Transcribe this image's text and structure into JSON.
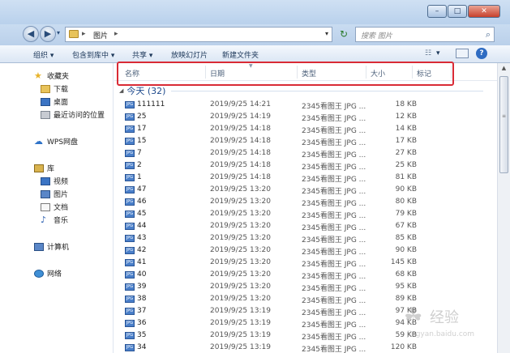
{
  "window": {
    "minimize": "–",
    "maximize": "□",
    "close": "✕"
  },
  "address": {
    "back_icon": "◀",
    "forward_icon": "▶",
    "path_sep_1": "▸",
    "path": "图片",
    "path_sep_2": "▸",
    "dropdown": "▾",
    "refresh_icon": "↻",
    "search_placeholder": "搜索 图片",
    "search_icon": "search-icon"
  },
  "toolbar": {
    "organize": "组织 ▾",
    "include_in_library": "包含到库中 ▾",
    "share": "共享 ▾",
    "slideshow": "放映幻灯片",
    "new_folder": "新建文件夹",
    "view_menu": "▾",
    "help": "?"
  },
  "nav": {
    "favorites": "收藏夹",
    "downloads": "下载",
    "desktop": "桌面",
    "recent": "最近访问的位置",
    "wps": "WPS网盘",
    "libraries": "库",
    "videos": "视频",
    "pictures": "图片",
    "documents": "文档",
    "music": "音乐",
    "computer": "计算机",
    "network": "网络"
  },
  "columns": {
    "name": "名称",
    "date": "日期",
    "type": "类型",
    "size": "大小",
    "tags": "标记"
  },
  "group": {
    "label": "今天 (32)"
  },
  "files": [
    {
      "name": "111111",
      "date": "2019/9/25 14:21",
      "type": "2345看图王 JPG ...",
      "size": "18 KB"
    },
    {
      "name": "25",
      "date": "2019/9/25 14:19",
      "type": "2345看图王 JPG ...",
      "size": "12 KB"
    },
    {
      "name": "17",
      "date": "2019/9/25 14:18",
      "type": "2345看图王 JPG ...",
      "size": "14 KB"
    },
    {
      "name": "15",
      "date": "2019/9/25 14:18",
      "type": "2345看图王 JPG ...",
      "size": "17 KB"
    },
    {
      "name": "7",
      "date": "2019/9/25 14:18",
      "type": "2345看图王 JPG ...",
      "size": "27 KB"
    },
    {
      "name": "2",
      "date": "2019/9/25 14:18",
      "type": "2345看图王 JPG ...",
      "size": "25 KB"
    },
    {
      "name": "1",
      "date": "2019/9/25 14:18",
      "type": "2345看图王 JPG ...",
      "size": "81 KB"
    },
    {
      "name": "47",
      "date": "2019/9/25 13:20",
      "type": "2345看图王 JPG ...",
      "size": "90 KB"
    },
    {
      "name": "46",
      "date": "2019/9/25 13:20",
      "type": "2345看图王 JPG ...",
      "size": "80 KB"
    },
    {
      "name": "45",
      "date": "2019/9/25 13:20",
      "type": "2345看图王 JPG ...",
      "size": "79 KB"
    },
    {
      "name": "44",
      "date": "2019/9/25 13:20",
      "type": "2345看图王 JPG ...",
      "size": "67 KB"
    },
    {
      "name": "43",
      "date": "2019/9/25 13:20",
      "type": "2345看图王 JPG ...",
      "size": "85 KB"
    },
    {
      "name": "42",
      "date": "2019/9/25 13:20",
      "type": "2345看图王 JPG ...",
      "size": "90 KB"
    },
    {
      "name": "41",
      "date": "2019/9/25 13:20",
      "type": "2345看图王 JPG ...",
      "size": "145 KB"
    },
    {
      "name": "40",
      "date": "2019/9/25 13:20",
      "type": "2345看图王 JPG ...",
      "size": "68 KB"
    },
    {
      "name": "39",
      "date": "2019/9/25 13:20",
      "type": "2345看图王 JPG ...",
      "size": "95 KB"
    },
    {
      "name": "38",
      "date": "2019/9/25 13:20",
      "type": "2345看图王 JPG ...",
      "size": "89 KB"
    },
    {
      "name": "37",
      "date": "2019/9/25 13:19",
      "type": "2345看图王 JPG ...",
      "size": "97 KB"
    },
    {
      "name": "36",
      "date": "2019/9/25 13:19",
      "type": "2345看图王 JPG ...",
      "size": "94 KB"
    },
    {
      "name": "35",
      "date": "2019/9/25 13:19",
      "type": "2345看图王 JPG ...",
      "size": "59 KB"
    },
    {
      "name": "34",
      "date": "2019/9/25 13:19",
      "type": "2345看图王 JPG ...",
      "size": "120 KB"
    }
  ],
  "file_badge": "JPG",
  "watermark": {
    "paw": "🐾",
    "text": "经验",
    "url": "jingyan.baidu.com"
  }
}
